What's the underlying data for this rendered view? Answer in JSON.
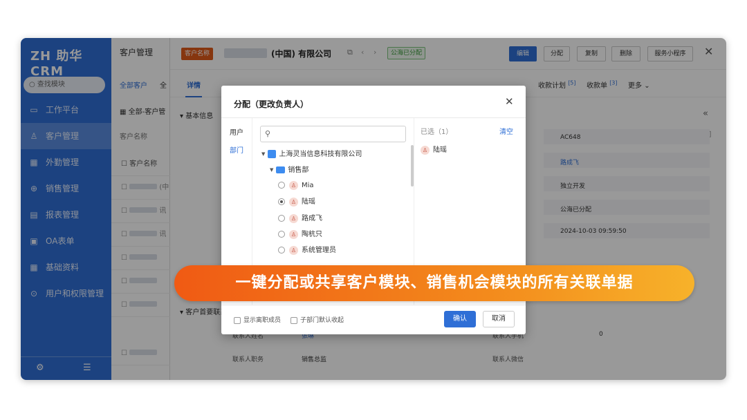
{
  "app": {
    "logo": "ZH 助华CRM"
  },
  "sidebar": {
    "search_placeholder": "查找模块",
    "items": [
      {
        "label": "工作平台",
        "icon": "monitor-icon"
      },
      {
        "label": "客户管理",
        "icon": "user-icon",
        "active": true
      },
      {
        "label": "外勤管理",
        "icon": "grid-icon"
      },
      {
        "label": "销售管理",
        "icon": "target-icon"
      },
      {
        "label": "报表管理",
        "icon": "report-icon"
      },
      {
        "label": "OA表单",
        "icon": "form-icon"
      },
      {
        "label": "基础资料",
        "icon": "grid-icon"
      },
      {
        "label": "用户和权限管理",
        "icon": "settings-icon"
      }
    ]
  },
  "list": {
    "title": "客户管理",
    "tab_all": "全部客户",
    "tab_more": "全",
    "view_label": "全部-客户管",
    "filter_label": "客户名称",
    "column_name": "客户名称",
    "row_suffixes": [
      "(中",
      "讯",
      "讯",
      "",
      "",
      "",
      ""
    ]
  },
  "detail": {
    "tag": "客户名称",
    "company": "(中国) 有限公司",
    "status_tag": "公海已分配",
    "buttons": {
      "edit": "编辑",
      "assign": "分配",
      "copy": "复制",
      "delete": "删除",
      "mini": "服务小程序",
      "more": "···"
    },
    "tabs": [
      {
        "label": "详情",
        "active": true
      },
      {
        "label": "收款计划",
        "count": "[5]"
      },
      {
        "label": "收款单",
        "count": "[3]"
      },
      {
        "label": "更多"
      }
    ],
    "section_basic": "基本信息",
    "section_contact": "客户首要联系人",
    "fields": [
      {
        "value": "AC648"
      },
      {
        "value": "路成飞",
        "link": true
      },
      {
        "value": "独立开发"
      },
      {
        "value": "公海已分配"
      },
      {
        "value": "2024-10-03 09:59:50"
      }
    ],
    "contact_rows": [
      {
        "label": "联系人姓名",
        "value": "张琳",
        "label2": "联系人手机",
        "value2": "0"
      },
      {
        "label": "联系人职务",
        "value": "销售总监",
        "label2": "联系人微信",
        "value2": ""
      }
    ]
  },
  "modal": {
    "title": "分配（更改负责人）",
    "left_tabs": [
      "用户",
      "部门"
    ],
    "search_placeholder": "",
    "tree": {
      "company": "上海灵当信息科技有限公司",
      "department": "销售部",
      "users": [
        {
          "name": "Mia",
          "checked": false
        },
        {
          "name": "陆瑶",
          "checked": true
        },
        {
          "name": "路成飞",
          "checked": false
        },
        {
          "name": "陶杭只",
          "checked": false
        },
        {
          "name": "系统管理员",
          "checked": false
        }
      ]
    },
    "selected_header": "已选（1）",
    "clear_label": "清空",
    "selected": [
      "陆瑶"
    ],
    "footer": {
      "show_resigned": "显示离职成员",
      "sub_dept_default": "子部门默认收起",
      "confirm": "确认",
      "cancel": "取消"
    }
  },
  "banner": {
    "text": "一键分配或共享客户模块、销售机会模块的所有关联单据"
  },
  "colors": {
    "primary": "#2f6fd6",
    "banner_start": "#f05a14",
    "banner_end": "#f7b22a"
  }
}
